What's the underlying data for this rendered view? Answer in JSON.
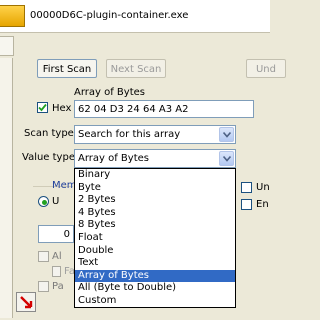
{
  "window": {
    "title": "00000D6C-plugin-container.exe"
  },
  "buttons": {
    "first_scan": "First Scan",
    "next_scan": "Next Scan",
    "undo_scan": "Und"
  },
  "scan_value": {
    "group_label": "Array of Bytes",
    "hex_label": "Hex",
    "hex_checked": true,
    "value": "62 04 D3 24 64 A3 A2"
  },
  "scan_type": {
    "label": "Scan type",
    "selected": "Search for this array"
  },
  "value_type": {
    "label": "Value type",
    "selected": "Array of Bytes",
    "options": [
      "Binary",
      "Byte",
      "2 Bytes",
      "4 Bytes",
      "8 Bytes",
      "Float",
      "Double",
      "Text",
      "Array of Bytes",
      "All (Byte to Double)",
      "Custom"
    ],
    "highlighted": "Array of Bytes"
  },
  "memory_options": {
    "group_label_partial": "Mem",
    "radio_partial": "U",
    "field_partial": "0",
    "check_partial_1": "Al",
    "check_partial_2": "Fa",
    "check_partial_3": "Pa"
  },
  "right_options": {
    "check_1_partial": "Un",
    "check_2_partial": "En"
  },
  "colors": {
    "selection": "#316ac5",
    "window_bg": "#ece9d8",
    "pointer_red": "#d40000"
  },
  "icons": [
    "app-icon",
    "chevron-down-icon",
    "pointer-arrow-icon"
  ]
}
